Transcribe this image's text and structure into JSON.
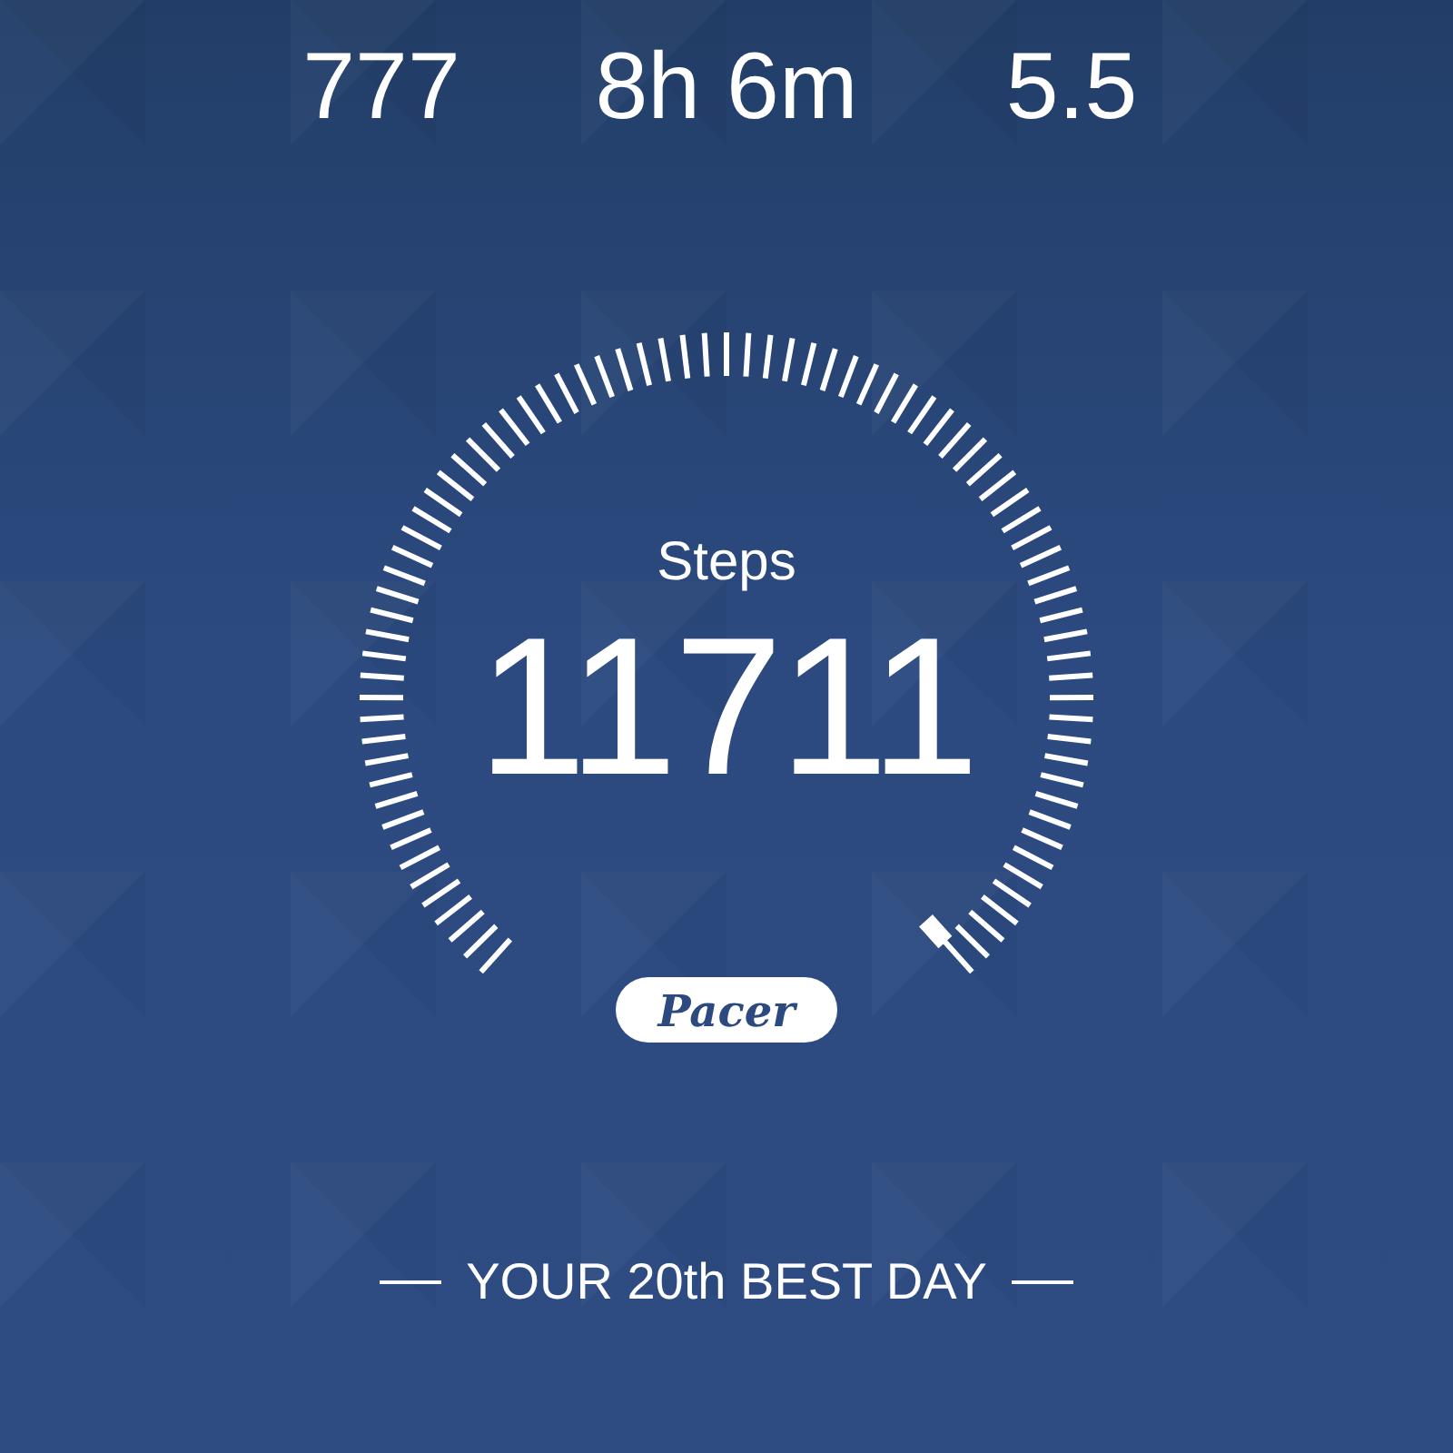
{
  "stats": [
    {
      "value": "777"
    },
    {
      "value": "8h 6m"
    },
    {
      "value": "5.5"
    }
  ],
  "gauge": {
    "label": "Steps",
    "value": "11711"
  },
  "brand": "Pacer",
  "footer": "YOUR 20th BEST DAY"
}
